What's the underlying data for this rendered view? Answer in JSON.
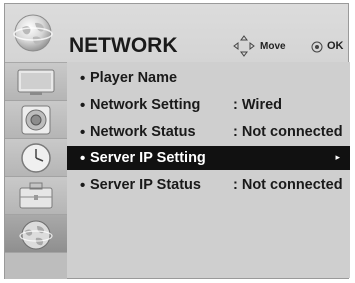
{
  "header": {
    "title": "NETWORK",
    "hints": {
      "move_label": "Move",
      "ok_label": "OK",
      "move_icon": "dpad-icon",
      "ok_icon": "ok-button-icon"
    }
  },
  "sidebar": {
    "items": [
      {
        "icon": "tv-screen-icon",
        "active": false
      },
      {
        "icon": "speaker-icon",
        "active": false
      },
      {
        "icon": "clock-icon",
        "active": false
      },
      {
        "icon": "toolbox-icon",
        "active": false
      },
      {
        "icon": "globe-network-icon",
        "active": true
      }
    ]
  },
  "menu": {
    "selected_index": 3,
    "rows": [
      {
        "label": "Player Name",
        "value": ""
      },
      {
        "label": "Network Setting",
        "value": ": Wired"
      },
      {
        "label": "Network Status",
        "value": ": Not connected"
      },
      {
        "label": "Server IP Setting",
        "value": "",
        "submenu_arrow": "▸"
      },
      {
        "label": "Server IP Status",
        "value": ": Not connected"
      }
    ]
  },
  "colors": {
    "selected_row_bg": "#111111",
    "text": "#1a1a1a",
    "selected_text": "#ffffff"
  }
}
